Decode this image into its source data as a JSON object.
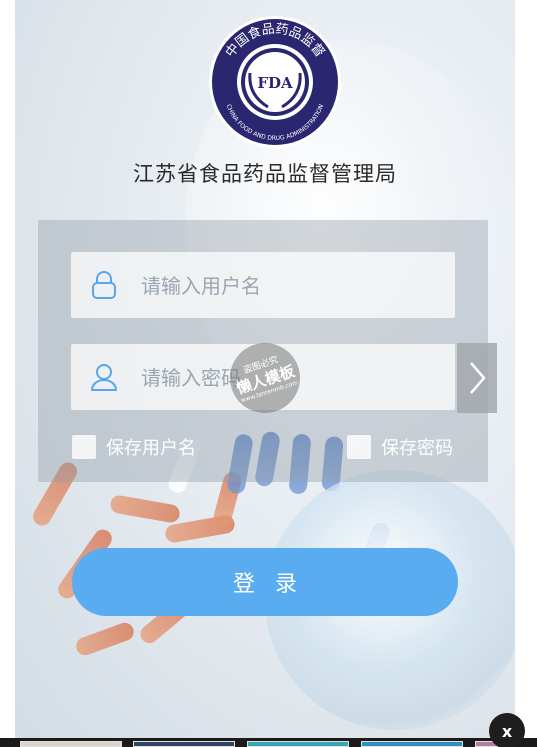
{
  "header": {
    "agency_title": "江苏省食品药品监督管理局"
  },
  "logo": {
    "center_text": "FDA",
    "ring_text_cn": "中国食品药品监督",
    "ring_text_en": "CHINA FOOD AND DRUG ADMINISTRATION"
  },
  "login_form": {
    "username_placeholder": "请输入用户名",
    "password_placeholder": "请输入密码",
    "remember_username_label": "保存用户名",
    "remember_password_label": "保存密码",
    "submit_label": "登录"
  },
  "watermark": {
    "top": "盗图必究",
    "main": "懒人模板",
    "sub": "www.lanrenmb.com"
  },
  "ad_bar": {
    "close_label": "x"
  },
  "colors": {
    "button_blue": "#5aacf0",
    "icon_blue": "#5aa6ea",
    "logo_navy": "#2b2670"
  },
  "icons": {
    "username": "lock-icon",
    "password": "user-icon",
    "next": "chevron-right-icon"
  }
}
